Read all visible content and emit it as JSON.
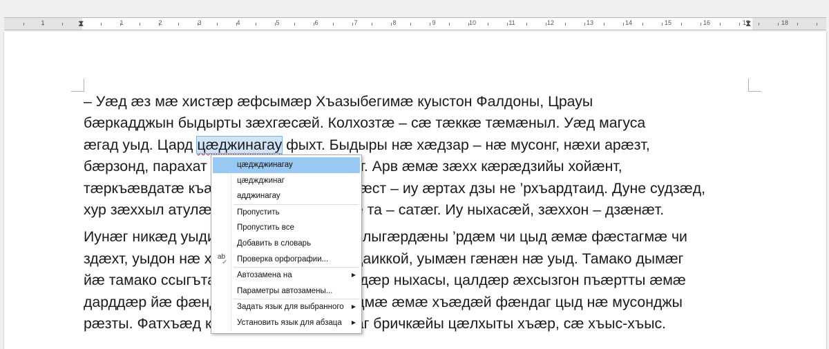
{
  "ruler": {
    "numbers": [
      "1",
      "1",
      "2",
      "3",
      "4",
      "5",
      "6",
      "7",
      "8",
      "9",
      "10",
      "11",
      "12",
      "13",
      "14",
      "15",
      "16",
      "17",
      "18"
    ]
  },
  "document": {
    "paragraphs": [
      [
        [
          "– Уæд æз мæ хистæр æфсымæр Хъазыбегимæ куыстон Фалдоны, Црауы"
        ],
        [
          "бæркадджын быдырты зæхгæсæй. Колхозтæ – сæ тæккæ тæмæныл. Уæд магуса"
        ],
        [
          "æгад уыд. Цард ",
          "цæджинагау",
          " фыхт. Быдыры нæ хæдзар – нæ мусонг, нæхи арæзт,"
        ],
        [
          "бæрзонд, парахат хæдзар. Фæлæ дзы ст. Арв æмæ зæхх кæрæдзийы хойæнт,"
        ],
        [
          "тæркъæвдатæ къæвдатæ æмæ æнæфсæст – иу æртах дзы не ’рхъардтаид. Дуне судзæд,"
        ],
        [
          "хур зæххыл атулæ, уæддæр нæ хъуамæ та – сатæг. Иу ныхасæй, зæххон – дзæнæт."
        ]
      ],
      [
        [
          "Иунæг никæд уыди, мах сыгъдæг фæхæлыгæрдæны ’рдæм чи цыд æмæ фæстагмæ чи"
        ],
        [
          "здæхт, уыдон нæ хæдзары бадтысты, адаиккой, уымæн гæнæн нæ уыд. Тамако дымæг"
        ],
        [
          "йæ тамако ссыгъта, æмæ тæрхон лæггадæр ныхасы, цалдæр æхсызгон пъæртты æмæ"
        ],
        [
          "дарддæр йæ фæндаг. Хæдзары бæстæдмæ æмæ хъæдæй фæндаг цыд нæ мусонджы"
        ],
        [
          "рæзты. Фатхъæд кæнæ тæрс суггæй дзаг бричкæйы цæлхыты хъæр, сæ хъыс-хъыс."
        ]
      ]
    ]
  },
  "context_menu": {
    "suggestions": [
      "цæджджинагау",
      "цæджджинаг",
      "адджинагау"
    ],
    "ignore": "Пропустить",
    "ignore_all": "Пропустить все",
    "add_to_dictionary": "Добавить в словарь",
    "spellcheck": "Проверка орфографии...",
    "autocorrect": "Автозамена на",
    "autocorrect_options": "Параметры автозамены...",
    "set_language_selection": "Задать язык для выбранного",
    "set_language_paragraph": "Установить язык для абзаца"
  }
}
